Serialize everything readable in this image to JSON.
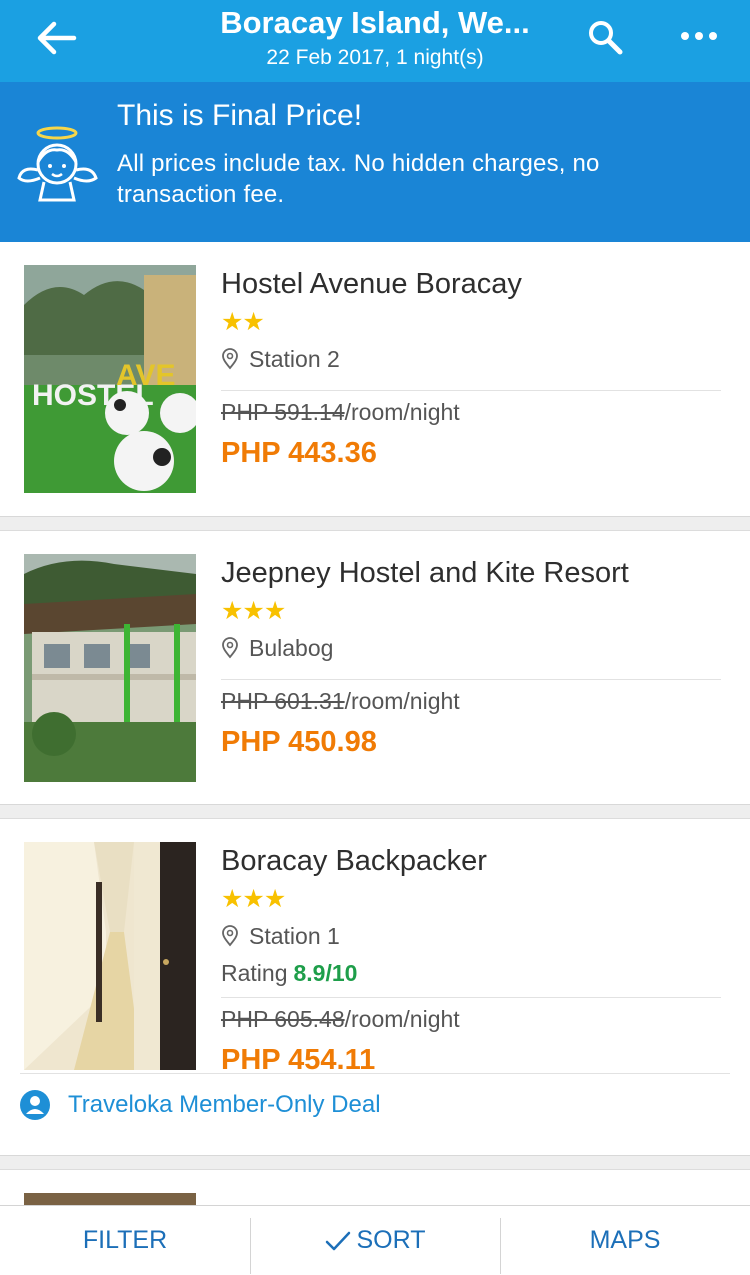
{
  "header": {
    "title": "Boracay Island, We...",
    "subtitle": "22 Feb 2017, 1 night(s)",
    "back_icon": "arrow-left-icon",
    "search_icon": "search-icon",
    "more_icon": "more-horizontal-icon"
  },
  "banner": {
    "title": "This is Final Price!",
    "text": "All prices include tax. No hidden charges, no transaction fee.",
    "icon": "angel-icon"
  },
  "hotels": [
    {
      "name": "Hostel Avenue Boracay",
      "stars": "★★",
      "star_count": 2,
      "location": "Station 2",
      "original_price": "PHP 591.14",
      "per": "/room/night",
      "price": "PHP 443.36"
    },
    {
      "name": "Jeepney Hostel and Kite Resort",
      "stars": "★★★",
      "star_count": 3,
      "location": "Bulabog",
      "original_price": "PHP 601.31",
      "per": "/room/night",
      "price": "PHP 450.98"
    },
    {
      "name": "Boracay Backpacker",
      "stars": "★★★",
      "star_count": 3,
      "location": "Station 1",
      "rating_label": "Rating",
      "rating_value": "8.9/10",
      "original_price": "PHP 605.48",
      "per": "/room/night",
      "price": "PHP 454.11",
      "deal": "Traveloka Member-Only Deal"
    }
  ],
  "bottom_bar": {
    "filter": "FILTER",
    "sort": "SORT",
    "maps": "MAPS"
  },
  "colors": {
    "header": "#1ba0e2",
    "banner": "#1a85d6",
    "price": "#f07b05",
    "stars": "#f8c100",
    "rating": "#1e9e4a",
    "link": "#1c6fb8"
  }
}
